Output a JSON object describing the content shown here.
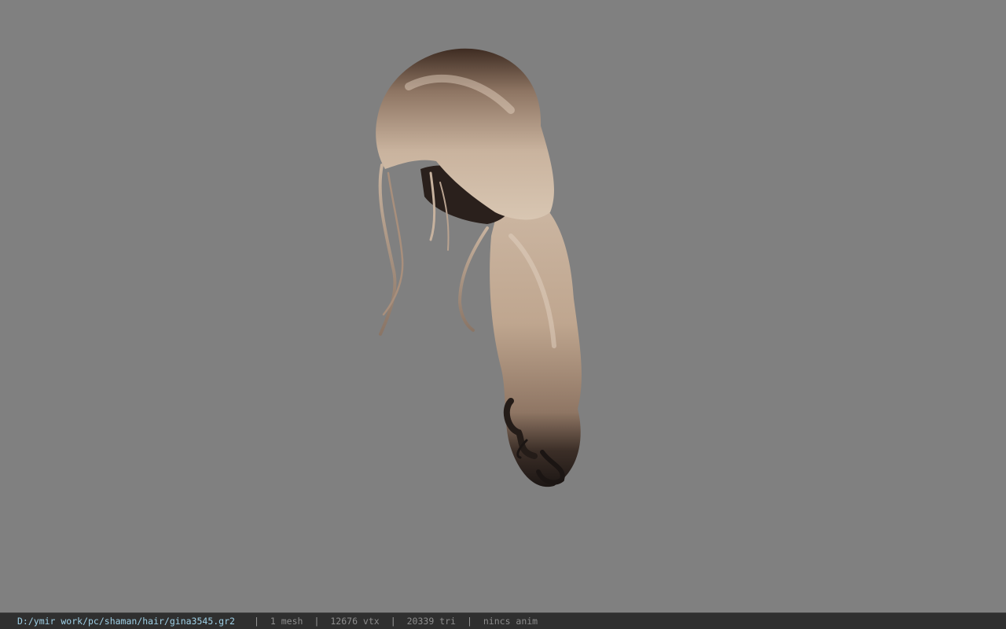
{
  "viewport": {
    "background": "#808080",
    "model": "hair-model"
  },
  "status_bar": {
    "file_path": "D:/ymir work/pc/shaman/hair/gina3545.gr2",
    "separator": "|",
    "mesh_count": "1 mesh",
    "vertex_count": "12676 vtx",
    "triangle_count": "20339 tri",
    "animation": "nincs anim"
  }
}
